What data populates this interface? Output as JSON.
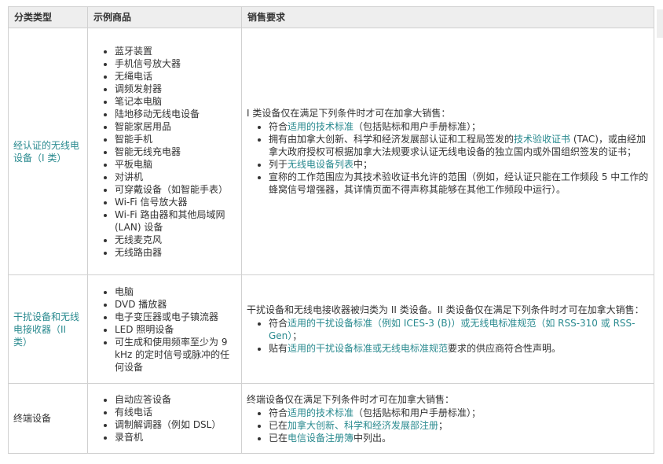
{
  "headers": [
    "分类类型",
    "示例商品",
    "销售要求"
  ],
  "rows": [
    {
      "category": "经认证的无线电设备（I 类）",
      "products": [
        "蓝牙装置",
        "手机信号放大器",
        "无绳电话",
        "调频发射器",
        "笔记本电脑",
        "陆地移动无线电设备",
        "智能家居用品",
        "智能手机",
        "智能无线充电器",
        "平板电脑",
        "对讲机",
        "可穿戴设备（如智能手表）",
        "Wi-Fi 信号放大器",
        "Wi-Fi 路由器和其他局域网 (LAN) 设备",
        "无线麦克风",
        "无线路由器"
      ],
      "intro": "I 类设备仅在满足下列条件时才可在加拿大销售：",
      "requirements": [
        {
          "pre": "符合",
          "link": "适用的技术标准",
          "post": "（包括贴标和用户手册标准）；"
        },
        {
          "pre": "拥有由加拿大创新、科学和经济发展部认证和工程局签发的",
          "link": "技术验收证书",
          "post": " (TAC)，或由经加拿大政府授权可根据加拿大法规要求认证无线电设备的独立国内或外国组织签发的证书；"
        },
        {
          "pre": "列于",
          "link": "无线电设备列表",
          "post": "中；"
        },
        {
          "pre": "宣称的工作范围应为其技术验收证书允许的范围（例如，经认证只能在工作频段 5 中工作的蜂窝信号增强器，其详情页面不得声称其能够在其他工作频段中运行）。",
          "link": "",
          "post": ""
        }
      ]
    },
    {
      "category": "干扰设备和无线电接收器（II 类）",
      "products": [
        "电脑",
        "DVD 播放器",
        "电子变压器或电子镇流器",
        "LED 照明设备",
        "可生成和使用频率至少为 9 kHz 的定时信号或脉冲的任何设备"
      ],
      "intro": "干扰设备和无线电接收器被归类为 II 类设备。II 类设备仅在满足下列条件时才可在加拿大销售：",
      "requirements": [
        {
          "pre": "符合",
          "link": "适用的干扰设备标准（例如 ICES-3 (B)）或无线电标准规范（如 RSS-310 或 RSS-Gen）",
          "post": "；"
        },
        {
          "pre": "贴有",
          "link": "适用的干扰设备标准或无线电标准规范",
          "post": "要求的供应商符合性声明。"
        }
      ]
    },
    {
      "category": "终端设备",
      "products": [
        "自动应答设备",
        "有线电话",
        "调制解调器（例如 DSL）",
        "录音机"
      ],
      "intro": "终端设备仅在满足下列条件时才可在加拿大销售：",
      "requirements": [
        {
          "pre": "符合",
          "link": "适用的技术标准",
          "post": "（包括贴标和用户手册标准）；"
        },
        {
          "pre": "已在",
          "link": "加拿大创新、科学和经济发展部注册",
          "post": "；"
        },
        {
          "pre": "已在",
          "link": "电信设备注册簿",
          "post": "中列出。"
        }
      ]
    }
  ]
}
